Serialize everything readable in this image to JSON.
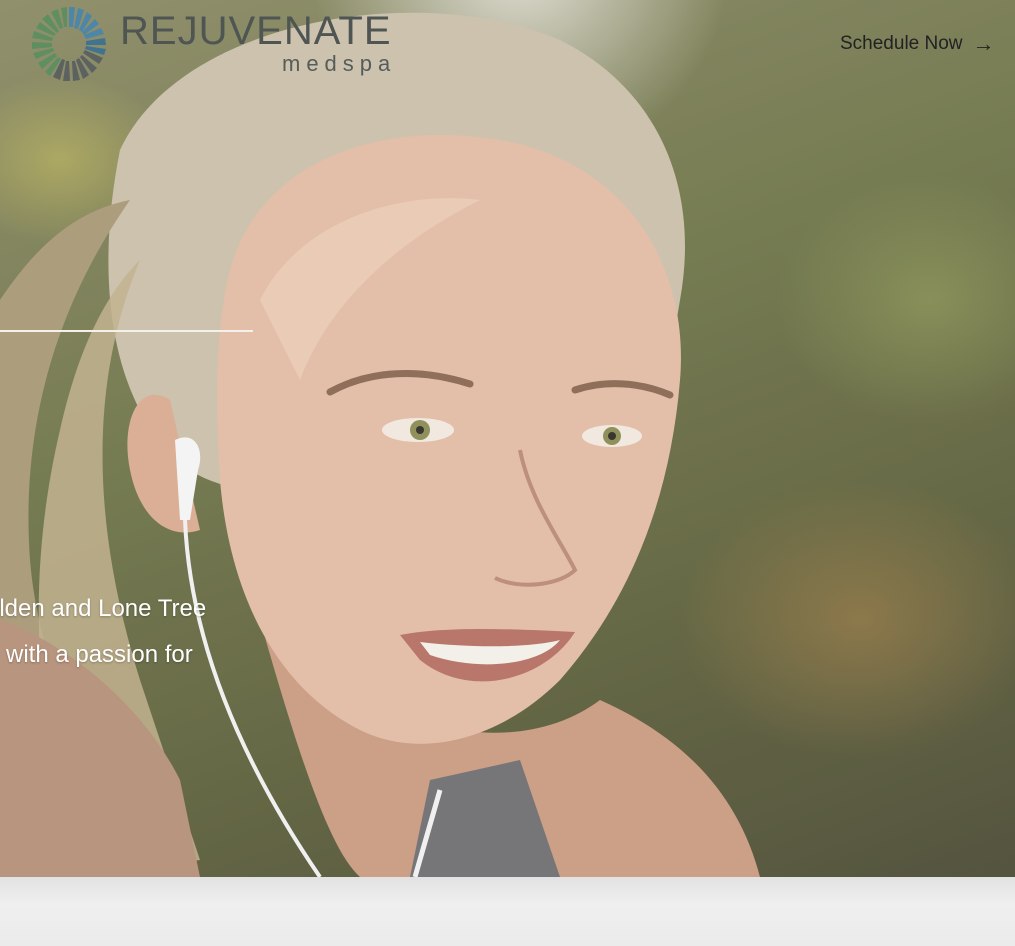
{
  "brand": {
    "name": "REJUVENATE",
    "sub": "medspa"
  },
  "header": {
    "cta_label": "Schedule Now",
    "cta_arrow": "→"
  },
  "hero": {
    "line1": "olden and Lone Tree",
    "line2": "with a passion for"
  },
  "colors": {
    "logo_green": "#5f8f61",
    "logo_blue": "#4e86a8",
    "logo_gray": "#5c625f",
    "brand_text": "#4e5553"
  }
}
